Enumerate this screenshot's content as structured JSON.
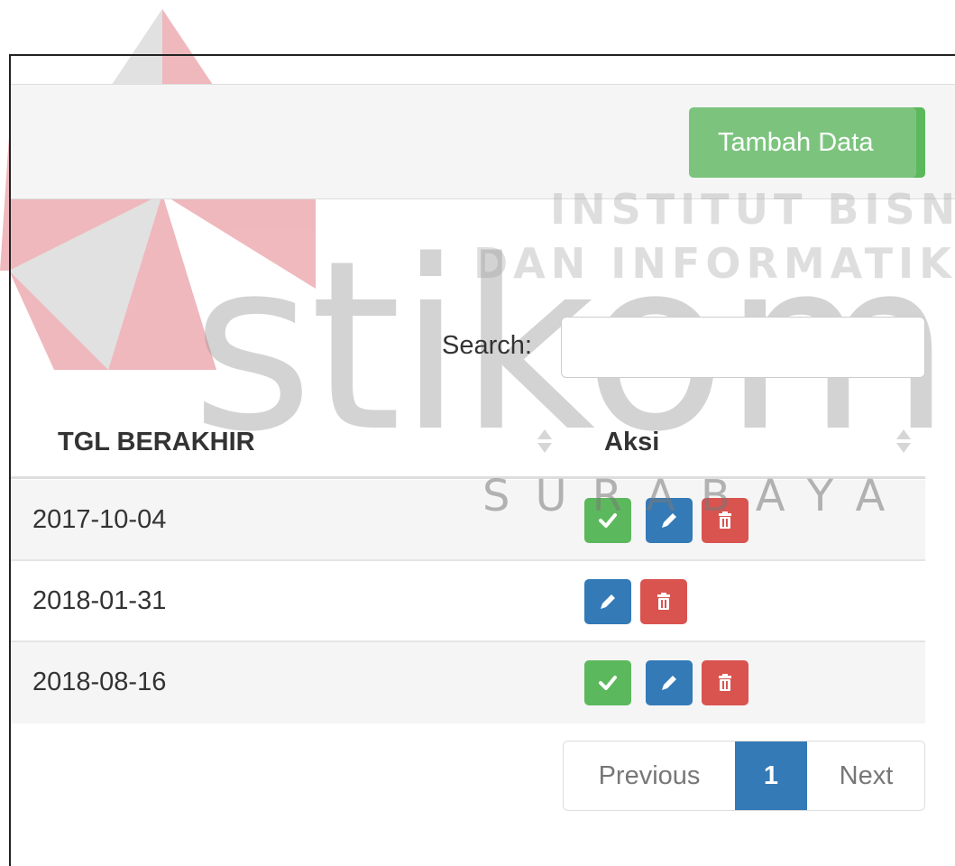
{
  "header": {
    "add_button_label": "Tambah Data"
  },
  "search": {
    "label": "Search:",
    "value": ""
  },
  "table": {
    "columns": [
      "TGL BERAKHIR",
      "Aksi"
    ],
    "rows": [
      {
        "date": "2017-10-04",
        "actions": [
          "approve-icon",
          "edit-icon",
          "delete-icon"
        ]
      },
      {
        "date": "2018-01-31",
        "actions": [
          "edit-icon",
          "delete-icon"
        ]
      },
      {
        "date": "2018-08-16",
        "actions": [
          "approve-icon",
          "edit-icon",
          "delete-icon"
        ]
      }
    ]
  },
  "pagination": {
    "previous": "Previous",
    "current": "1",
    "next": "Next"
  },
  "watermark": {
    "line1": "INSTITUT BISNIS",
    "line2": "DAN INFORMATIKA",
    "brand": "stikom",
    "city": "SURABAYA"
  },
  "colors": {
    "success": "#5cb85c",
    "primary": "#337ab7",
    "danger": "#d9534f",
    "logo_red": "#e8a0a6"
  }
}
